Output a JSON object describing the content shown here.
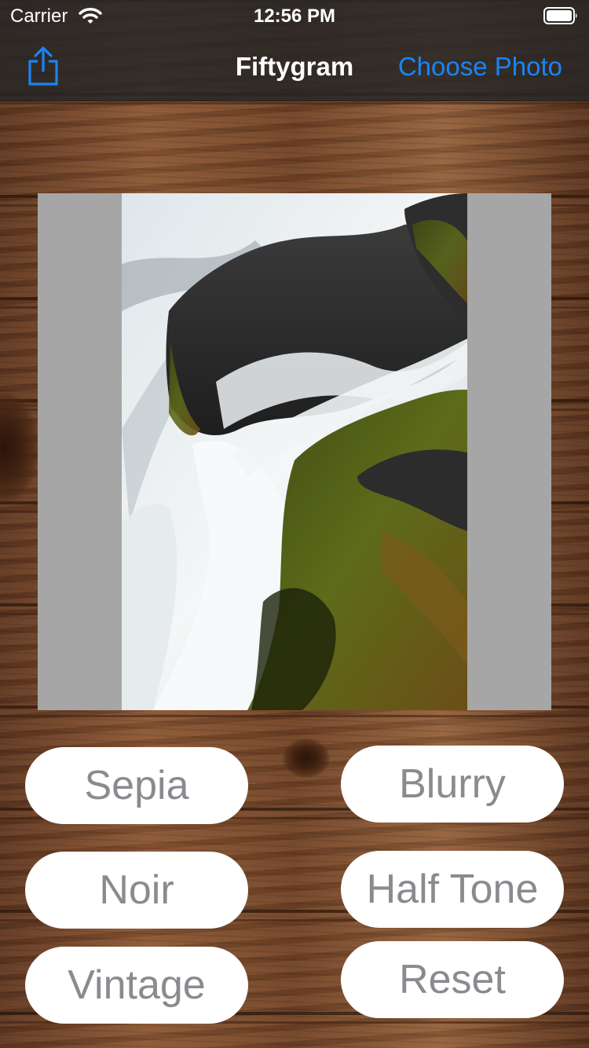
{
  "status_bar": {
    "carrier": "Carrier",
    "time": "12:56 PM",
    "wifi_icon": "wifi-icon",
    "battery_icon": "battery-icon"
  },
  "nav": {
    "title": "Fiftygram",
    "choose_photo": "Choose Photo",
    "share_icon": "share-icon"
  },
  "colors": {
    "accent": "#1a84f4",
    "nav_background": "#262626",
    "button_text": "#8a8a8f",
    "image_background": "#a6a6a6"
  },
  "filters": {
    "sepia": "Sepia",
    "blurry": "Blurry",
    "noir": "Noir",
    "half_tone": "Half Tone",
    "vintage": "Vintage",
    "reset": "Reset"
  }
}
